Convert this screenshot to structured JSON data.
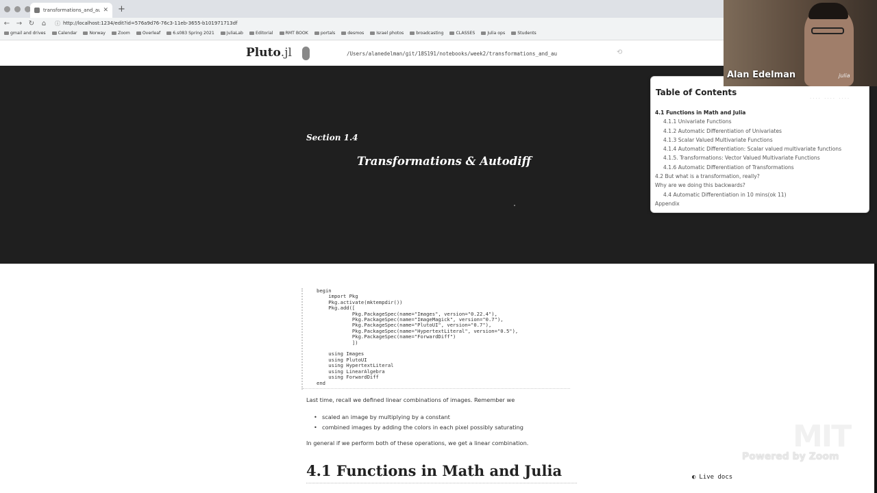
{
  "browser": {
    "tab_title": "transformations_and_autodi",
    "new_tab": "+",
    "url": "http://localhost:1234/edit?id=576a9d76-76c3-11eb-3655-b101971713df",
    "bookmarks": [
      "gmail and drives",
      "Calendar",
      "Norway",
      "Zoom",
      "Overleaf",
      "6.s083 Spring 2021",
      "JuliaLab",
      "Editorial",
      "RMT BOOK",
      "portals",
      "desmos",
      "Israel photos",
      "broadcasting",
      "CLASSES",
      "Julia ops",
      "Students"
    ]
  },
  "pluto": {
    "logo": "Pluto",
    "logo_ext": ".jl",
    "path": "/Users/alanedelman/git/18S191/notebooks/week2/transformations_and_au"
  },
  "banner": {
    "section": "Section 1.4",
    "title": "Transformations & Autodiff"
  },
  "toc": {
    "title": "Table of Contents",
    "items": [
      {
        "label": "4.1 Functions in Math and Julia",
        "level": 1,
        "active": true
      },
      {
        "label": "4.1.1 Univariate Functions",
        "level": 2
      },
      {
        "label": "4.1.2 Automatic Differentiation of Univariates",
        "level": 2
      },
      {
        "label": "4.1.3 Scalar Valued Multivariate Functions",
        "level": 2
      },
      {
        "label": "4.1.4 Automatic Differentiation: Scalar valued multivariate functions",
        "level": 2
      },
      {
        "label": "4.1.5. Transformations: Vector Valued Multivariate Functions",
        "level": 2
      },
      {
        "label": "4.1.6 Automatic Differentiation of Transformations",
        "level": 2
      },
      {
        "label": "4.2 But what is a transformation, really?",
        "level": 1
      },
      {
        "label": "Why are we doing this backwards?",
        "level": 1
      },
      {
        "label": "4.4 Automatic Differentiation in 10 mins(ok 11)",
        "level": 2
      },
      {
        "label": "Appendix",
        "level": 1
      }
    ]
  },
  "video": {
    "name": "Alan Edelman",
    "brand": "julia"
  },
  "notebook": {
    "code_lines": [
      "begin",
      "    import Pkg",
      "    Pkg.activate(mktempdir())",
      "    Pkg.add([",
      "            Pkg.PackageSpec(name=\"Images\", version=\"0.22.4\"),",
      "            Pkg.PackageSpec(name=\"ImageMagick\", version=\"0.7\"),",
      "            Pkg.PackageSpec(name=\"PlutoUI\", version=\"0.7\"),",
      "            Pkg.PackageSpec(name=\"HypertextLiteral\", version=\"0.5\"),",
      "            Pkg.PackageSpec(name=\"ForwardDiff\")",
      "            ])",
      "",
      "    using Images",
      "    using PlutoUI",
      "    using HypertextLiteral",
      "    using LinearAlgebra",
      "    using ForwardDiff",
      "end"
    ],
    "intro": "Last time, recall we defined linear combinations of images. Remember we",
    "bullets": [
      "scaled an image by multiplying by a constant",
      "combined images by adding the colors in each pixel possibly saturating"
    ],
    "summary": "In general if we perform both of these operations, we get a linear combination.",
    "heading": "4.1 Functions in Math and Julia"
  },
  "overlay": {
    "mit": "MIT",
    "powered": "Powered by Zoom",
    "live_docs": "Live docs"
  }
}
